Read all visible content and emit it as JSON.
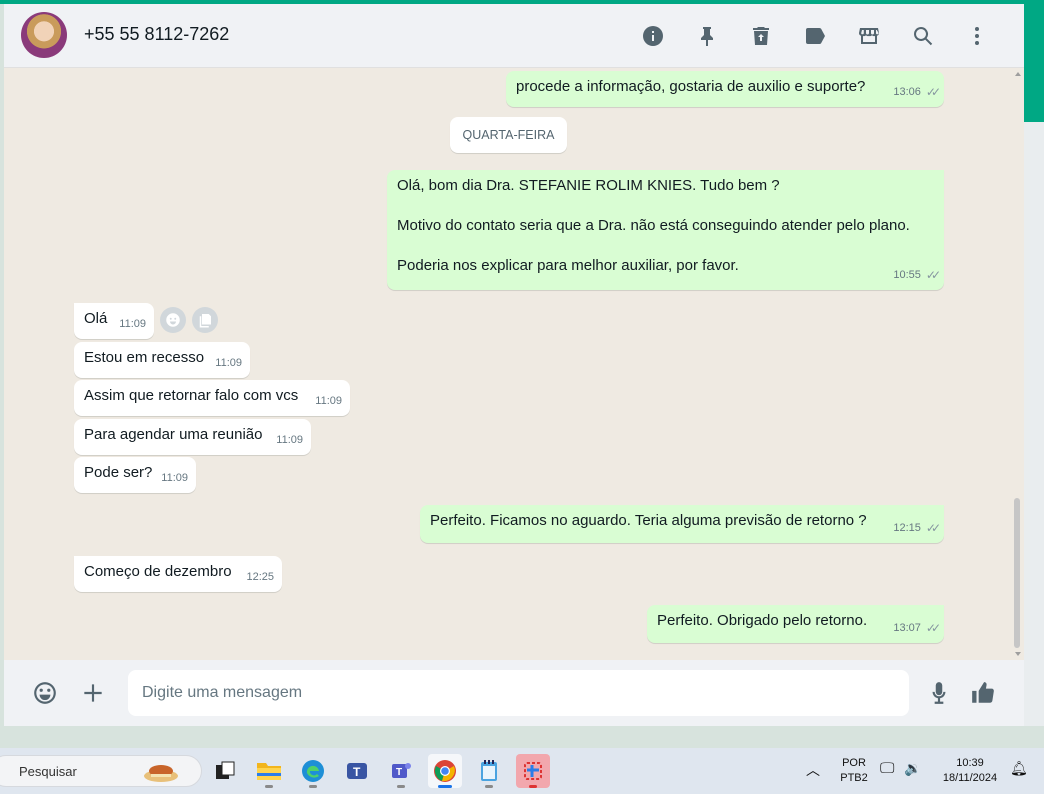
{
  "header": {
    "contact": "+55 55 8112-7262",
    "icons": [
      "info-icon",
      "pin-icon",
      "delete-icon",
      "label-icon",
      "catalog-icon",
      "search-icon",
      "menu-icon"
    ]
  },
  "date_separator": "QUARTA-FEIRA",
  "messages": [
    {
      "dir": "out",
      "text": "procede a informação, gostaria de auxilio e suporte?",
      "time": "13:06",
      "ticks": "✓✓"
    },
    {
      "dir": "out",
      "paragraphs": [
        "Olá, bom dia Dra. STEFANIE ROLIM KNIES. Tudo bem ?",
        "Motivo do contato seria que a Dra. não está conseguindo atender pelo plano.",
        "Poderia nos explicar para melhor auxiliar, por favor."
      ],
      "time": "10:55",
      "ticks": "✓✓"
    },
    {
      "dir": "in",
      "text": "Olá",
      "time": "11:09"
    },
    {
      "dir": "in",
      "text": "Estou em recesso",
      "time": "11:09"
    },
    {
      "dir": "in",
      "text": "Assim que retornar falo com vcs",
      "time": "11:09"
    },
    {
      "dir": "in",
      "text": "Para agendar uma reunião",
      "time": "11:09"
    },
    {
      "dir": "in",
      "text": "Pode ser?",
      "time": "11:09"
    },
    {
      "dir": "out",
      "text": "Perfeito. Ficamos no aguardo. Teria alguma previsão de retorno ?",
      "time": "12:15",
      "ticks": "✓✓"
    },
    {
      "dir": "in",
      "text": "Começo de dezembro",
      "time": "12:25"
    },
    {
      "dir": "out",
      "text": "Perfeito. Obrigado pelo retorno.",
      "time": "13:07",
      "ticks": "✓✓"
    }
  ],
  "composer": {
    "placeholder": "Digite uma mensagem"
  },
  "taskbar": {
    "search_label": "Pesquisar",
    "lang_top": "POR",
    "lang_bottom": "PTB2",
    "time": "10:39",
    "date": "18/11/2024"
  },
  "colors": {
    "accent": "#00a884",
    "outgoing_bubble": "#d9fdd3",
    "incoming_bubble": "#ffffff",
    "chat_background": "#efeae2"
  }
}
